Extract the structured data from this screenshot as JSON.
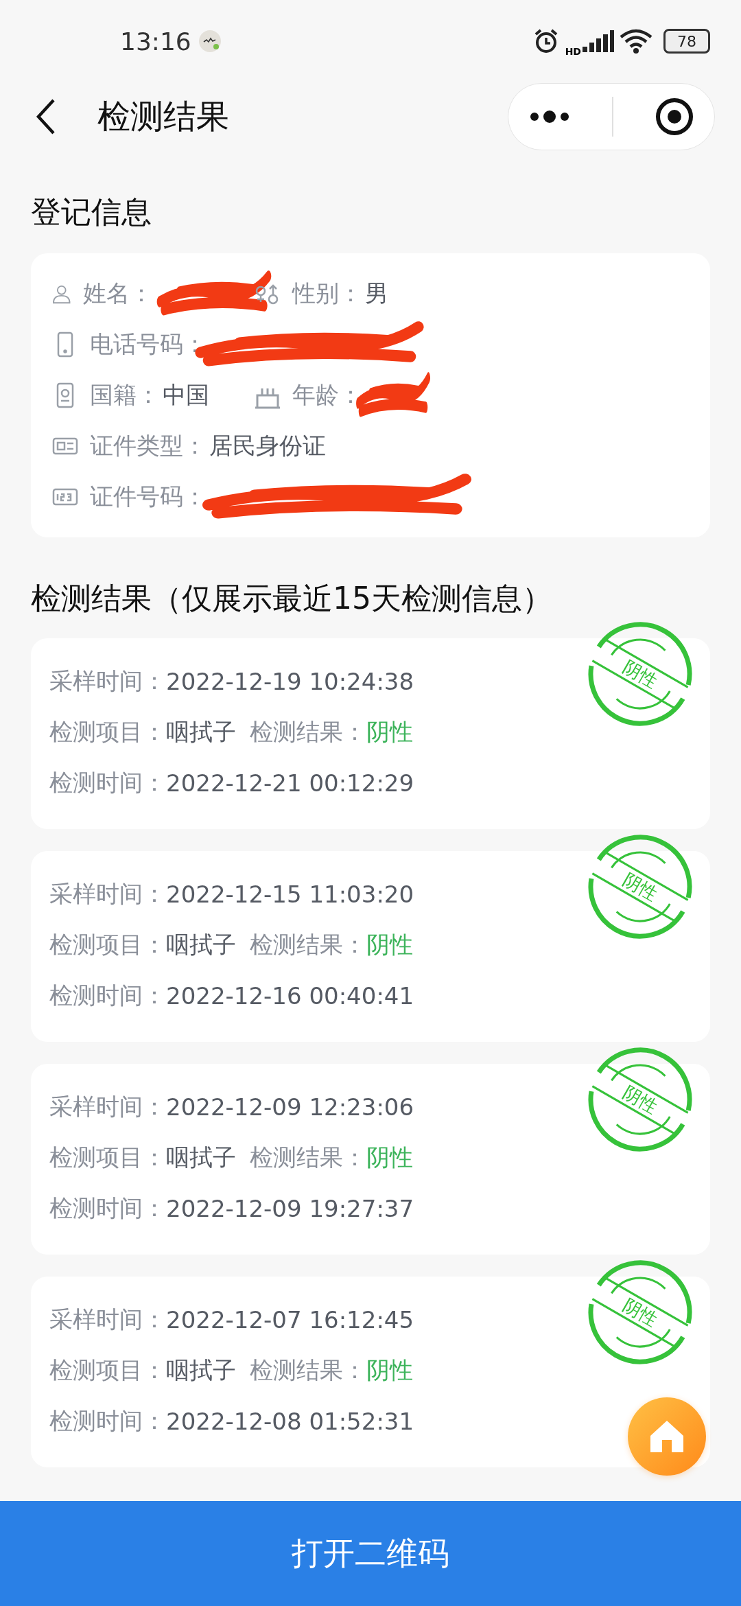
{
  "status_bar": {
    "time": "13:16",
    "network_label": "HD",
    "battery": "78"
  },
  "nav": {
    "title": "检测结果"
  },
  "registration": {
    "title": "登记信息",
    "rows": [
      [
        {
          "kind": "person",
          "label": "姓名：",
          "redacted": true
        },
        {
          "kind": "gender",
          "label": "性别：",
          "value": "男",
          "redacted": false
        }
      ],
      [
        {
          "kind": "phone",
          "label": "电话号码：",
          "redacted": true
        }
      ],
      [
        {
          "kind": "nationality",
          "label": "国籍：",
          "value": "中国",
          "redacted": false
        },
        {
          "kind": "cake",
          "label": "年龄：",
          "redacted": true
        }
      ],
      [
        {
          "kind": "idcard",
          "label": "证件类型：",
          "value": "居民身份证",
          "redacted": false
        }
      ],
      [
        {
          "kind": "number",
          "label": "证件号码：",
          "redacted": true
        }
      ]
    ]
  },
  "results": {
    "title": "检测结果（仅展示最近15天检测信息）",
    "items": [
      {
        "stamp": "阴性",
        "sample_label": "采样时间：",
        "sample_time": "2022-12-19 10:24:38",
        "item_label": "检测项目：",
        "item": "咽拭子",
        "result_label": "检测结果：",
        "result": "阴性",
        "test_label": "检测时间：",
        "test_time": "2022-12-21 00:12:29"
      },
      {
        "stamp": "阴性",
        "sample_label": "采样时间：",
        "sample_time": "2022-12-15 11:03:20",
        "item_label": "检测项目：",
        "item": "咽拭子",
        "result_label": "检测结果：",
        "result": "阴性",
        "test_label": "检测时间：",
        "test_time": "2022-12-16 00:40:41"
      },
      {
        "stamp": "阴性",
        "sample_label": "采样时间：",
        "sample_time": "2022-12-09 12:23:06",
        "item_label": "检测项目：",
        "item": "咽拭子",
        "result_label": "检测结果：",
        "result": "阴性",
        "test_label": "检测时间：",
        "test_time": "2022-12-09 19:27:37"
      },
      {
        "stamp": "阴性",
        "sample_label": "采样时间：",
        "sample_time": "2022-12-07 16:12:45",
        "item_label": "检测项目：",
        "item": "咽拭子",
        "result_label": "检测结果：",
        "result": "阴性",
        "test_label": "检测时间：",
        "test_time": "2022-12-08 01:52:31"
      }
    ]
  },
  "bottom_button": "打开二维码"
}
